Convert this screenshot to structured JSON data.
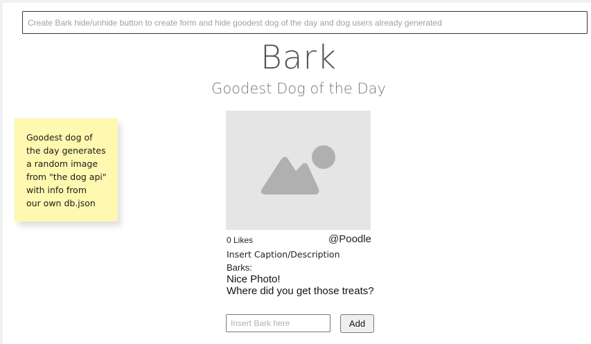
{
  "banner": {
    "placeholder": "Create Bark hide/unhide button to create form and hide goodest dog of the day and dog users already generated"
  },
  "header": {
    "title": "Bark",
    "subtitle": "Goodest Dog of the Day"
  },
  "sticky_note": {
    "text": "Goodest dog of\nthe day generates\na random image\nfrom \"the dog api\"\nwith info from\nour own db.json"
  },
  "post": {
    "image_icon": "image-placeholder-icon",
    "likes": "0 Likes",
    "breed": "@Poodle",
    "caption": "Insert Caption/Description",
    "barks_label": "Barks:",
    "comments": [
      "Nice Photo!",
      "Where did you get those treats?"
    ]
  },
  "bark_form": {
    "input_placeholder": "Insert Bark here",
    "add_label": "Add"
  },
  "colors": {
    "sticky_background": "#fff8b0",
    "image_placeholder": "#e5e5e5",
    "image_glyph": "#b0b0b0"
  }
}
